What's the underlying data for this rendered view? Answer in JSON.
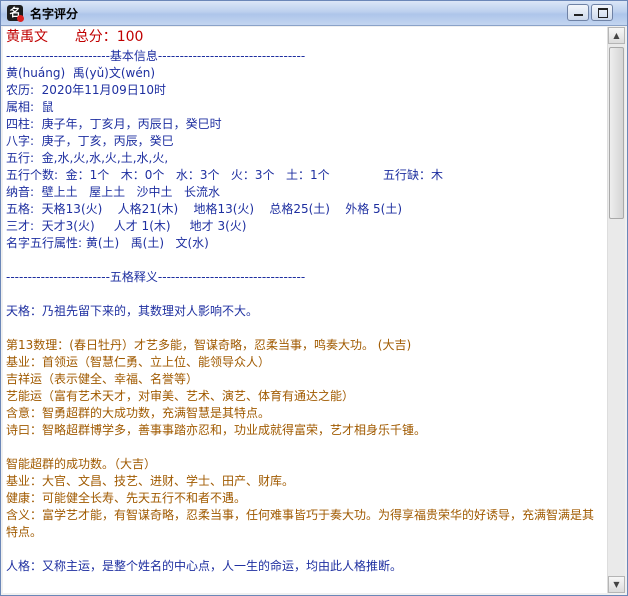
{
  "window": {
    "title": "名字评分"
  },
  "name_line": {
    "name": "黄禹文",
    "score_label": "总分：",
    "score": "100"
  },
  "sections": {
    "basic_title_line": "------------------------基本信息----------------------------------",
    "wuge_title_line": "------------------------五格释义----------------------------------"
  },
  "basic": {
    "pinyin": "黄(huáng)  禹(yǔ)文(wén)",
    "lunar": "农历:  2020年11月09日10时",
    "shengxiao": "属相:  鼠",
    "sizhu": "四柱:  庚子年，丁亥月，丙辰日，癸巳时",
    "bazi": "八字:  庚子，丁亥，丙辰，癸巳",
    "wuxing": "五行:  金,水,火,水,火,土,水,火,",
    "wuxing_count": "五行个数:  金：1个   木：0个   水：3个   火：3个   土：1个              五行缺：木",
    "nayin": "纳音:  壁上土   屋上土   沙中土   长流水",
    "wuge": "五格:  天格13(火)    人格21(木)    地格13(火)    总格25(土)    外格 5(土)",
    "sancai": "三才:  天才3(火)     人才 1(木)     地才 3(火)",
    "name_wuxing": "名字五行属性: 黄(土)   禹(土)   文(水)"
  },
  "tiange": {
    "intro": "天格：乃祖先留下来的，其数理对人影响不大。",
    "number_title": "第13数理：(春日牡丹）才艺多能，智谋奇略，忍柔当事，鸣奏大功。 (大吉)",
    "jiye": "基业：首领运（智慧仁勇、立上位、能领导众人）",
    "jixiang": "吉祥运（表示健全、幸福、名誉等）",
    "yiyun": "艺能运（富有艺术天才，对审美、艺术、演艺、体育有通达之能）",
    "hanyi": "含意：智勇超群的大成功数，充满智慧是其特点。",
    "shiyue": "诗曰：智略超群博学多，善事事踏亦忍和，功业成就得富荣，艺才相身乐千锺。"
  },
  "tiange2": {
    "title": "智能超群的成功数。（大吉）",
    "jiye": "基业：大官、文昌、技艺、进财、学士、田产、财库。",
    "jiankang": "健康：可能健全长寿、先天五行不和者不遇。",
    "hanyi": "含义：富学艺才能，有智谋奇略，忍柔当事，任何难事皆巧于奏大功。为得享福贵荣华的好诱导，充满智满是其特点。"
  },
  "renge": {
    "intro": "人格：又称主运，是整个姓名的中心点，人一生的命运，均由此人格推断。"
  },
  "scrollbar": {
    "up": "▲",
    "down": "▼"
  }
}
